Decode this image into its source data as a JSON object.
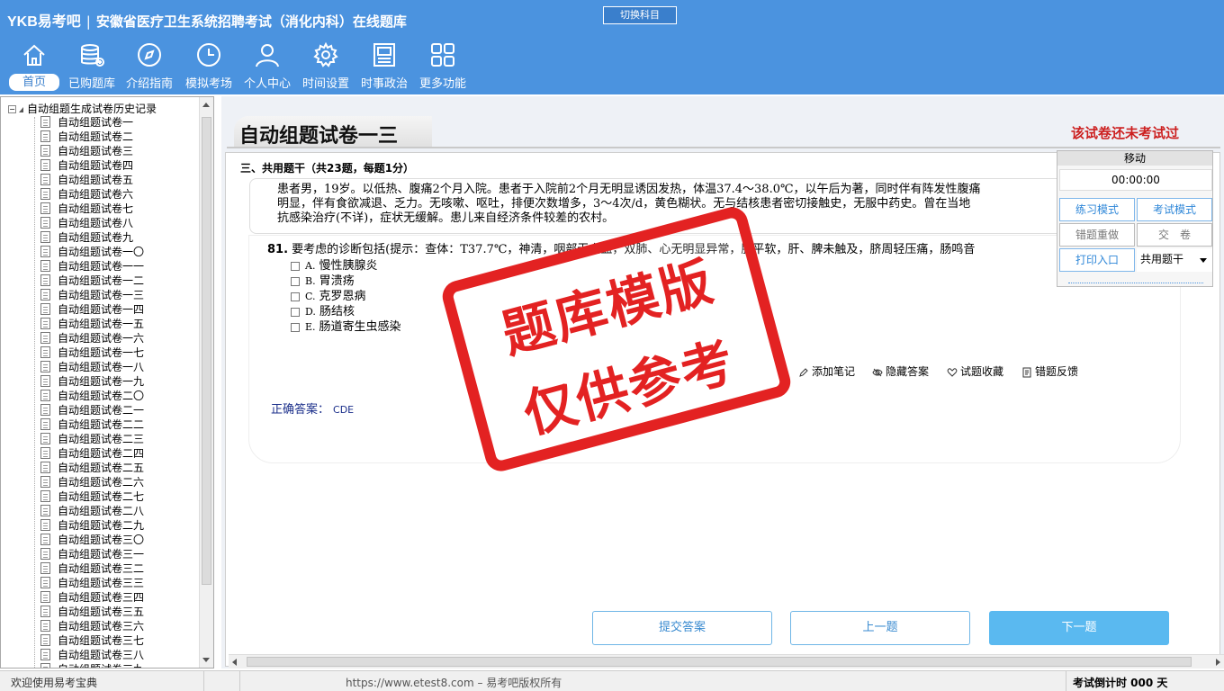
{
  "header": {
    "logo": "YKB易考吧",
    "title": "安徽省医疗卫生系统招聘考试（消化内科）在线题库",
    "switch_subject": "切换科目",
    "nav": [
      {
        "label": "首页",
        "icon": "home-icon"
      },
      {
        "label": "已购题库",
        "icon": "database-icon"
      },
      {
        "label": "介绍指南",
        "icon": "compass-icon"
      },
      {
        "label": "模拟考场",
        "icon": "clock-icon"
      },
      {
        "label": "个人中心",
        "icon": "user-icon"
      },
      {
        "label": "时间设置",
        "icon": "gear-icon"
      },
      {
        "label": "时事政治",
        "icon": "news-icon"
      },
      {
        "label": "更多功能",
        "icon": "grid-icon"
      }
    ]
  },
  "tree": {
    "root": "自动组题生成试卷历史记录",
    "items": [
      "自动组题试卷一",
      "自动组题试卷二",
      "自动组题试卷三",
      "自动组题试卷四",
      "自动组题试卷五",
      "自动组题试卷六",
      "自动组题试卷七",
      "自动组题试卷八",
      "自动组题试卷九",
      "自动组题试卷一〇",
      "自动组题试卷一一",
      "自动组题试卷一二",
      "自动组题试卷一三",
      "自动组题试卷一四",
      "自动组题试卷一五",
      "自动组题试卷一六",
      "自动组题试卷一七",
      "自动组题试卷一八",
      "自动组题试卷一九",
      "自动组题试卷二〇",
      "自动组题试卷二一",
      "自动组题试卷二二",
      "自动组题试卷二三",
      "自动组题试卷二四",
      "自动组题试卷二五",
      "自动组题试卷二六",
      "自动组题试卷二七",
      "自动组题试卷二八",
      "自动组题试卷二九",
      "自动组题试卷三〇",
      "自动组题试卷三一",
      "自动组题试卷三二",
      "自动组题试卷三三",
      "自动组题试卷三四",
      "自动组题试卷三五",
      "自动组题试卷三六",
      "自动组题试卷三七",
      "自动组题试卷三八",
      "自动组题试卷三九"
    ]
  },
  "paper": {
    "title": "自动组题试卷一三",
    "status": "该试卷还未考试过",
    "section": "三、共用题干（共23题，每题1分）",
    "stem_lines": [
      "患者男，19岁。以低热、腹痛2个月入院。患者于入院前2个月无明显诱因发热，体温37.4～38.0℃，以午后为著，同时伴有阵发性腹痛",
      "明显，伴有食欲减退、乏力。无咳嗽、呕吐，排便次数增多，3～4次/d，黄色糊状。无与结核患者密切接触史，无服中药史。曾在当地",
      "抗感染治疗(不详)，症状无缓解。患儿来自经济条件较差的农村。"
    ],
    "question_number": "81.",
    "question_text": "要考虑的诊断包括(提示：查体：T37.7℃，神清，咽部无充血，双肺、心无明显异常，腹平软，肝、脾未触及，脐周轻压痛，肠鸣音",
    "options": [
      {
        "letter": "A.",
        "text": "慢性胰腺炎"
      },
      {
        "letter": "B.",
        "text": "胃溃疡"
      },
      {
        "letter": "C.",
        "text": "克罗恩病"
      },
      {
        "letter": "D.",
        "text": "肠结核"
      },
      {
        "letter": "E.",
        "text": "肠道寄生虫感染"
      }
    ],
    "tools": [
      "添加笔记",
      "隐藏答案",
      "试题收藏",
      "错题反馈"
    ],
    "answer_label": "正确答案：",
    "answer_value": "CDE"
  },
  "stamp": {
    "line1": "题库模版",
    "line2": "仅供参考"
  },
  "buttons": {
    "submit": "提交答案",
    "prev": "上一题",
    "next": "下一题"
  },
  "control": {
    "move": "移动",
    "timer": "00:00:00",
    "practice_mode": "练习模式",
    "exam_mode": "考试模式",
    "redo_wrong": "错题重做",
    "submit_paper": "交　卷",
    "print": "打印入口",
    "select_value": "共用题干"
  },
  "status": {
    "welcome": "欢迎使用易考宝典",
    "copyright": "https://www.etest8.com – 易考吧版权所有",
    "countdown": "考试倒计时 000 天"
  },
  "colors": {
    "header_bg": "#4b93df",
    "accent": "#3a8bd0",
    "status_red": "#cc1f1f",
    "stamp_red": "#e32222"
  }
}
